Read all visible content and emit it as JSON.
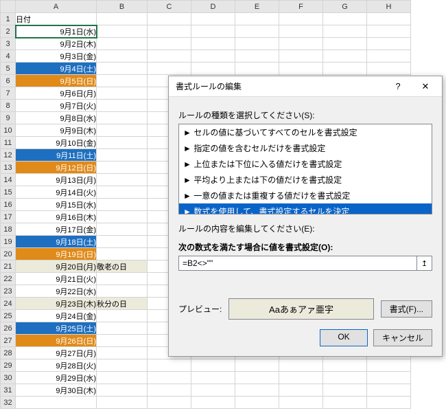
{
  "columns": [
    "A",
    "B",
    "C",
    "D",
    "E",
    "F",
    "G",
    "H"
  ],
  "header": {
    "A": "日付"
  },
  "rows": [
    {
      "n": 1,
      "A": "日付",
      "cls": "",
      "B": ""
    },
    {
      "n": 2,
      "A": "9月1日(水)",
      "cls": "active",
      "B": ""
    },
    {
      "n": 3,
      "A": "9月2日(木)",
      "cls": "",
      "B": ""
    },
    {
      "n": 4,
      "A": "9月3日(金)",
      "cls": "",
      "B": ""
    },
    {
      "n": 5,
      "A": "9月4日(土)",
      "cls": "sat",
      "B": ""
    },
    {
      "n": 6,
      "A": "9月5日(日)",
      "cls": "sun",
      "B": ""
    },
    {
      "n": 7,
      "A": "9月6日(月)",
      "cls": "",
      "B": ""
    },
    {
      "n": 8,
      "A": "9月7日(火)",
      "cls": "",
      "B": ""
    },
    {
      "n": 9,
      "A": "9月8日(水)",
      "cls": "",
      "B": ""
    },
    {
      "n": 10,
      "A": "9月9日(木)",
      "cls": "",
      "B": ""
    },
    {
      "n": 11,
      "A": "9月10日(金)",
      "cls": "",
      "B": ""
    },
    {
      "n": 12,
      "A": "9月11日(土)",
      "cls": "sat",
      "B": ""
    },
    {
      "n": 13,
      "A": "9月12日(日)",
      "cls": "sun",
      "B": ""
    },
    {
      "n": 14,
      "A": "9月13日(月)",
      "cls": "",
      "B": ""
    },
    {
      "n": 15,
      "A": "9月14日(火)",
      "cls": "",
      "B": ""
    },
    {
      "n": 16,
      "A": "9月15日(水)",
      "cls": "",
      "B": ""
    },
    {
      "n": 17,
      "A": "9月16日(木)",
      "cls": "",
      "B": ""
    },
    {
      "n": 18,
      "A": "9月17日(金)",
      "cls": "",
      "B": ""
    },
    {
      "n": 19,
      "A": "9月18日(土)",
      "cls": "sat",
      "B": ""
    },
    {
      "n": 20,
      "A": "9月19日(日)",
      "cls": "sun",
      "B": ""
    },
    {
      "n": 21,
      "A": "9月20日(月)",
      "cls": "",
      "B": "敬老の日",
      "hol": true
    },
    {
      "n": 22,
      "A": "9月21日(火)",
      "cls": "",
      "B": ""
    },
    {
      "n": 23,
      "A": "9月22日(水)",
      "cls": "",
      "B": ""
    },
    {
      "n": 24,
      "A": "9月23日(木)",
      "cls": "",
      "B": "秋分の日",
      "hol": true
    },
    {
      "n": 25,
      "A": "9月24日(金)",
      "cls": "",
      "B": ""
    },
    {
      "n": 26,
      "A": "9月25日(土)",
      "cls": "sat",
      "B": ""
    },
    {
      "n": 27,
      "A": "9月26日(日)",
      "cls": "sun",
      "B": ""
    },
    {
      "n": 28,
      "A": "9月27日(月)",
      "cls": "",
      "B": ""
    },
    {
      "n": 29,
      "A": "9月28日(火)",
      "cls": "",
      "B": ""
    },
    {
      "n": 30,
      "A": "9月29日(水)",
      "cls": "",
      "B": ""
    },
    {
      "n": 31,
      "A": "9月30日(木)",
      "cls": "",
      "B": ""
    },
    {
      "n": 32,
      "A": "",
      "cls": "",
      "B": ""
    }
  ],
  "dialog": {
    "title": "書式ルールの編集",
    "help": "?",
    "close": "✕",
    "ruleTypeLabel": "ルールの種類を選択してください(S):",
    "ruleTypes": [
      "セルの値に基づいてすべてのセルを書式設定",
      "指定の値を含むセルだけを書式設定",
      "上位または下位に入る値だけを書式設定",
      "平均より上または下の値だけを書式設定",
      "一意の値または重複する値だけを書式設定",
      "数式を使用して、書式設定するセルを決定"
    ],
    "ruleSelected": 5,
    "editLabel": "ルールの内容を編集してください(E):",
    "formulaLabel": "次の数式を満たす場合に値を書式設定(O):",
    "formula": "=B2<>\"\"",
    "previewLabel": "プレビュー:",
    "previewSample": "Aaあぁアァ亜宇",
    "formatBtn": "書式(F)...",
    "ok": "OK",
    "cancel": "キャンセル"
  }
}
